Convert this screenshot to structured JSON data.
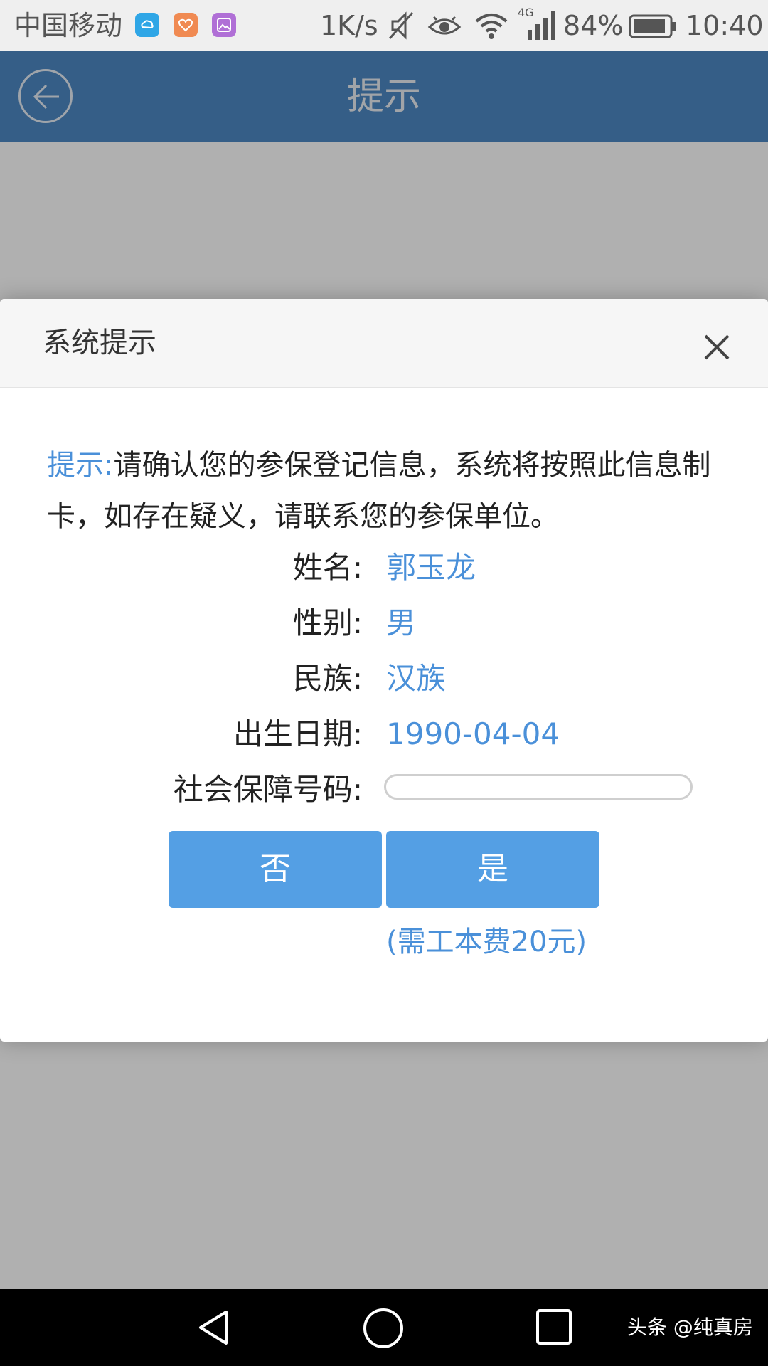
{
  "status_bar": {
    "carrier": "中国移动",
    "net_speed": "1K/s",
    "network_type": "4G",
    "battery": "84%",
    "time": "10:40"
  },
  "header": {
    "title": "提示"
  },
  "dialog": {
    "title": "系统提示",
    "notice_label": "提示:",
    "notice_text": "请确认您的参保登记信息，系统将按照此信息制卡，如存在疑义，请联系您的参保单位。",
    "fields": [
      {
        "label": "姓名:",
        "value": "郭玉龙"
      },
      {
        "label": "性别:",
        "value": "男"
      },
      {
        "label": "民族:",
        "value": "汉族"
      },
      {
        "label": "出生日期:",
        "value": "1990-04-04"
      },
      {
        "label": "社会保障号码:",
        "value": ""
      }
    ],
    "no_button": "否",
    "yes_button": "是",
    "fee_note": "(需工本费20元)"
  },
  "watermark": "头条 @纯真房",
  "colors": {
    "header": "#4d88c4",
    "accent": "#4a90d9",
    "button": "#549fe4"
  }
}
